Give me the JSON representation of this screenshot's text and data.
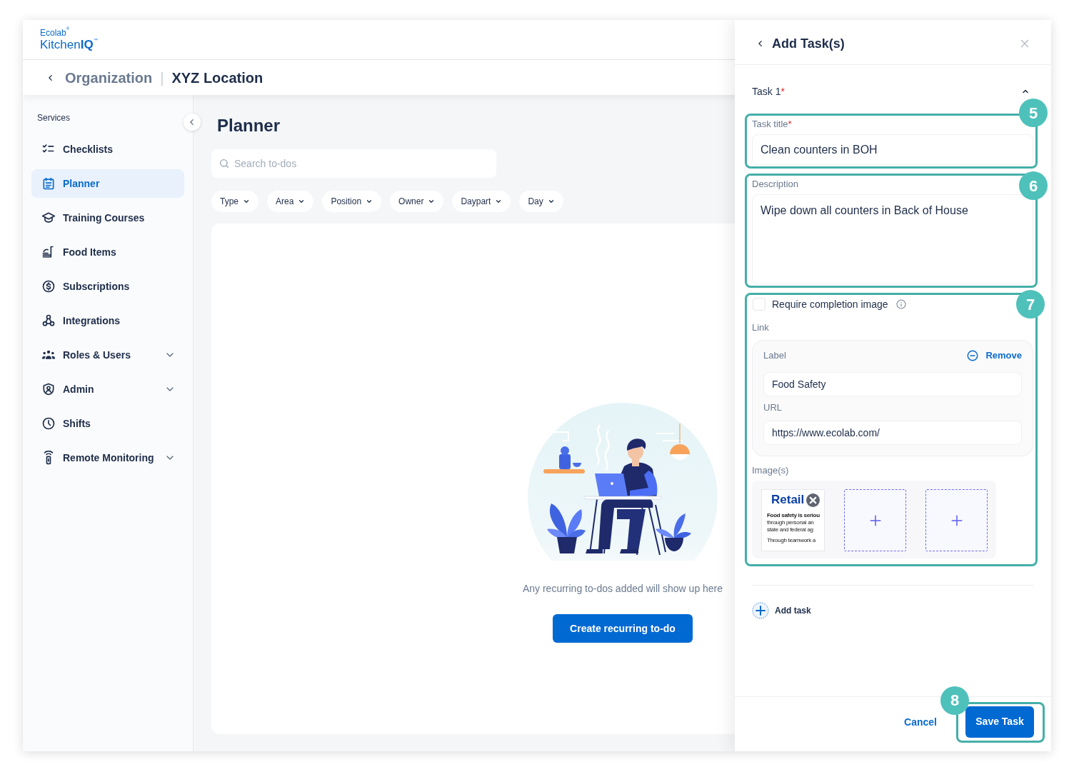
{
  "header": {
    "logo": {
      "brand": "Ecolab$^{®}$",
      "product": "Kitchen**IQ**$^{™}$"
    }
  },
  "breadcrumb": {
    "items": [
      {
        "label": "Organization",
        "selected": false
      },
      {
        "label": "XYZ Location",
        "selected": true
      }
    ],
    "separator": "|"
  },
  "sidebar": {
    "section_label": "Services",
    "items": [
      {
        "label": "Checklists",
        "kind": "link",
        "selected": false
      },
      {
        "label": "Planner",
        "kind": "link",
        "selected": true
      },
      {
        "label": "Training Courses",
        "kind": "link",
        "selected": false
      },
      {
        "label": "Food Items",
        "kind": "link",
        "selected": false
      },
      {
        "label": "Subscriptions",
        "kind": "link",
        "selected": false
      },
      {
        "label": "Integrations",
        "kind": "link",
        "selected": false
      },
      {
        "label": "Roles & Users",
        "kind": "group",
        "selected": false
      },
      {
        "label": "Admin",
        "kind": "group",
        "selected": false
      },
      {
        "label": "Shifts",
        "kind": "link",
        "selected": false
      },
      {
        "label": "Remote Monitoring",
        "kind": "group",
        "selected": false
      }
    ]
  },
  "main": {
    "title": "Planner",
    "search": {
      "placeholder": "Search to-dos"
    },
    "filters": [
      "Type",
      "Area",
      "Position",
      "Owner",
      "Daypart",
      "Day"
    ],
    "empty_state": {
      "message": "Any recurring to-dos added will show up here",
      "button": "Create recurring to-do"
    }
  },
  "drawer": {
    "title": "Add Task(s)",
    "tasks": [
      {
        "heading": "Task 1",
        "required_mark": "*",
        "expanded": true,
        "title_field": {
          "label": "Task title",
          "required_mark": "*",
          "value": "Clean counters in BOH",
          "callout": "5"
        },
        "description_field": {
          "label": "Description",
          "value": "Wipe down all counters in Back of House",
          "callout": "6"
        },
        "attachments": {
          "callout": "7",
          "require_image": {
            "label": "Require completion image",
            "checked": false
          },
          "link": {
            "heading": "Link",
            "label_field": {
              "label": "Label",
              "value": "Food Safety"
            },
            "remove_button": "Remove",
            "url_field": {
              "label": "URL",
              "value": "https://www.ecolab.com/"
            }
          },
          "images": {
            "heading": "Image(s)",
            "items": [
              {
                "kind": "uploaded",
                "title": "Retail",
                "lines": [
                  {
                    "kind": "lead",
                    "text": "Food safety is seriou"
                  },
                  {
                    "kind": "body",
                    "text": "through personal an"
                  },
                  {
                    "kind": "body",
                    "text": "state and federal ag"
                  },
                  {
                    "kind": "paragraph",
                    "text": "Through teamwork a"
                  }
                ]
              },
              {
                "kind": "empty"
              },
              {
                "kind": "empty"
              }
            ]
          }
        }
      }
    ],
    "add_task_button": "Add task",
    "footer": {
      "cancel_button": "Cancel",
      "save_button": "Save Task",
      "save_callout": "8"
    }
  }
}
